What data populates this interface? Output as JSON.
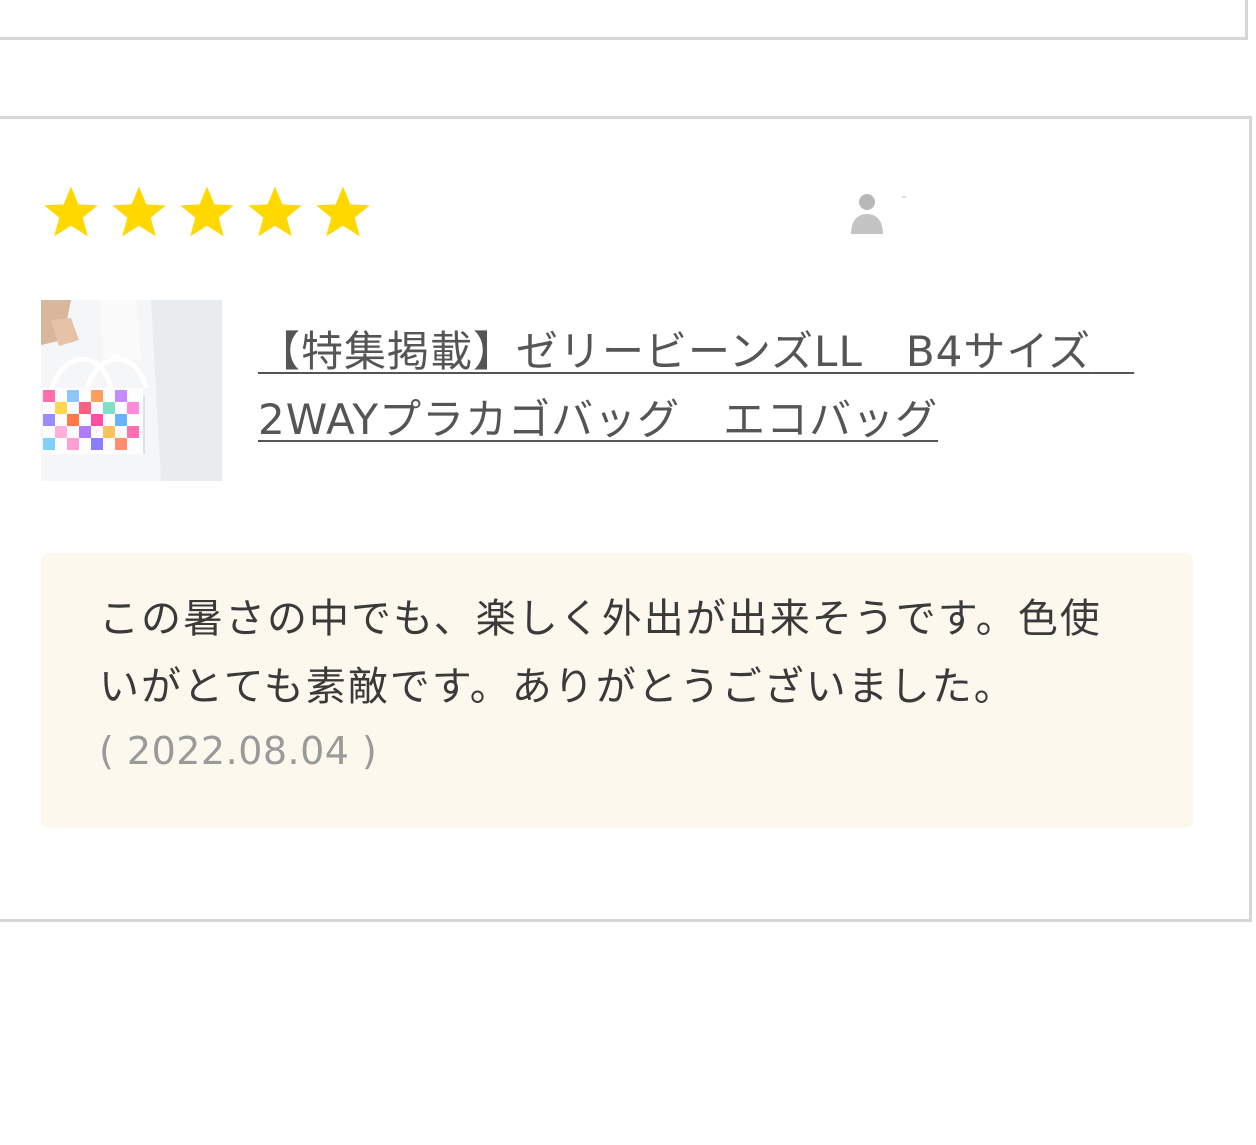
{
  "review": {
    "rating": 5,
    "max_rating": 5,
    "star_color": "#ffd800",
    "reviewer_icon": "user-icon",
    "product": {
      "title": "【特集掲載】ゼリービーンズLL　B4サイズ　2WAYプラカゴバッグ　エコバッグ"
    },
    "comment": "この暑さの中でも、楽しく外出が出来そうです。色使いがとても素敵です。ありがとうございました。",
    "date": "( 2022.08.04 )"
  },
  "colors": {
    "border": "#d6d6d6",
    "comment_background": "#fcf8ee",
    "link_text": "#555555",
    "date_text": "#9a9a9a"
  }
}
